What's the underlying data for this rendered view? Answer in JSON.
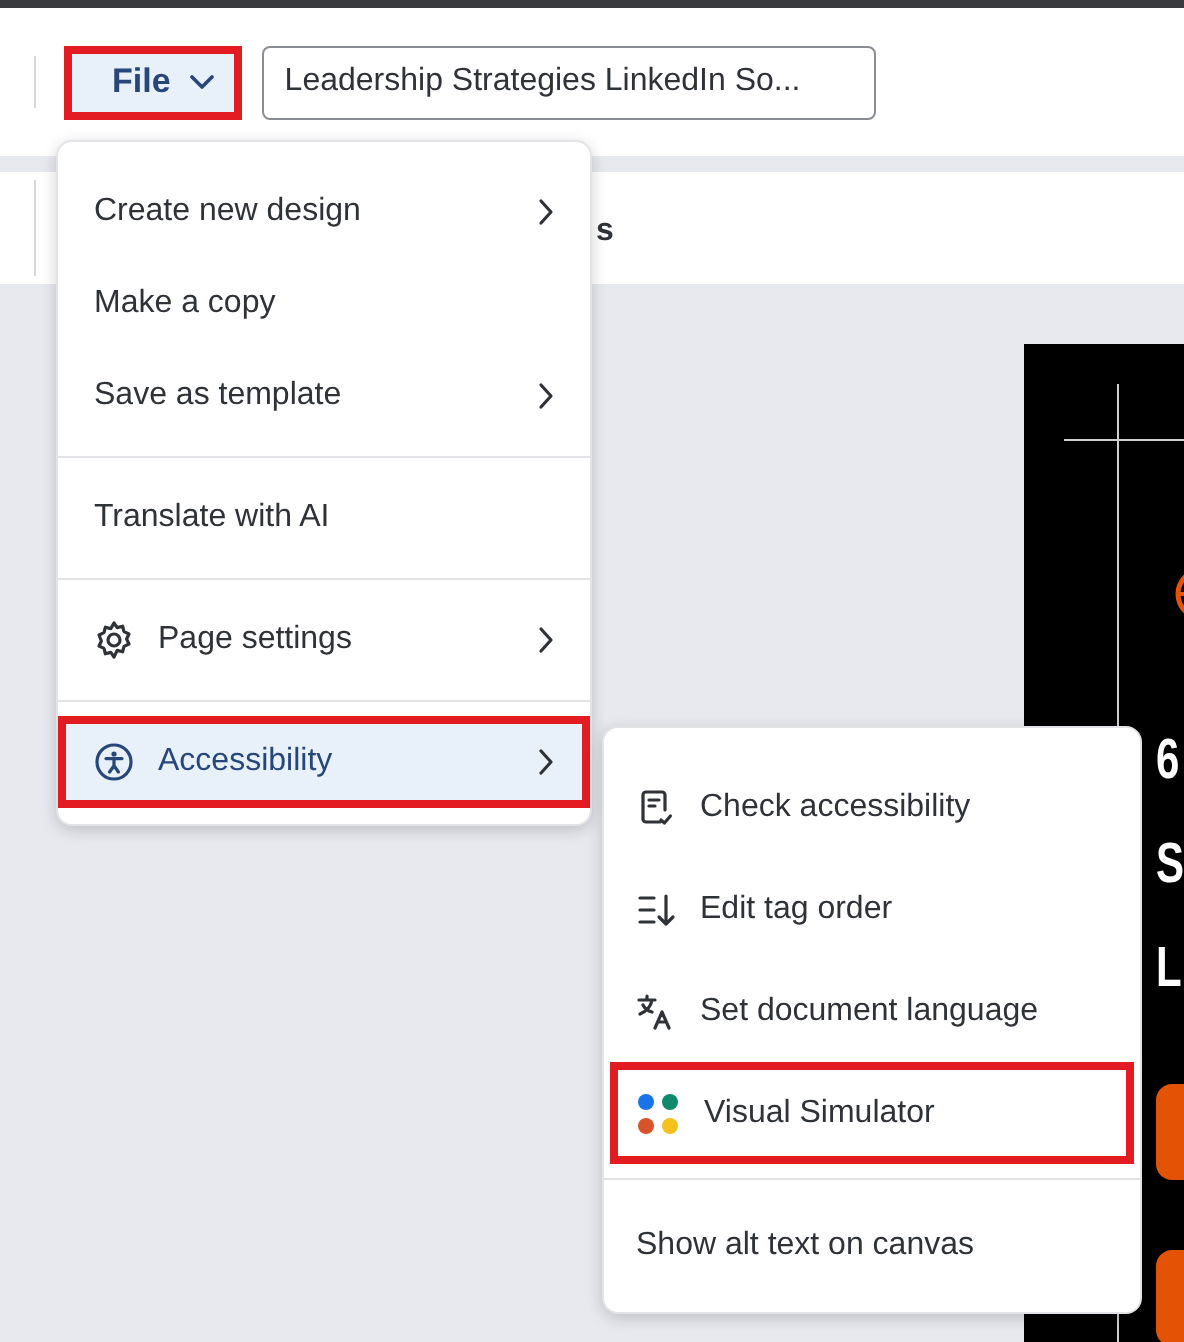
{
  "header": {
    "file_button": {
      "label": "File",
      "highlighted": true
    },
    "title_field": {
      "value": "Leadership Strategies LinkedIn So..."
    }
  },
  "toolbar": {
    "text": "s"
  },
  "file_menu": {
    "items": [
      {
        "kind": "item",
        "label": "Create new design",
        "submenu": true,
        "selected": false,
        "highlighted": false
      },
      {
        "kind": "item",
        "label": "Make a copy",
        "submenu": false,
        "selected": false,
        "highlighted": false
      },
      {
        "kind": "item",
        "label": "Save as template",
        "submenu": true,
        "selected": false,
        "highlighted": false
      },
      {
        "kind": "divider"
      },
      {
        "kind": "item",
        "label": "Translate with AI",
        "submenu": false,
        "selected": false,
        "highlighted": false
      },
      {
        "kind": "divider"
      },
      {
        "kind": "item",
        "label": "Page settings",
        "submenu": true,
        "selected": false,
        "highlighted": false
      },
      {
        "kind": "divider"
      },
      {
        "kind": "item",
        "label": "Accessibility",
        "submenu": true,
        "selected": true,
        "highlighted": true
      }
    ]
  },
  "accessibility_menu": {
    "items": [
      {
        "kind": "item",
        "label": "Check accessibility",
        "highlighted": false
      },
      {
        "kind": "item",
        "label": "Edit tag order",
        "highlighted": false
      },
      {
        "kind": "item",
        "label": "Set document language",
        "highlighted": false
      },
      {
        "kind": "item",
        "label": "Visual Simulator",
        "highlighted": true
      },
      {
        "kind": "divider"
      },
      {
        "kind": "item",
        "label": "Show alt text on canvas",
        "highlighted": false
      }
    ]
  },
  "canvas": {
    "letters": [
      "6",
      "S",
      "L"
    ]
  }
}
